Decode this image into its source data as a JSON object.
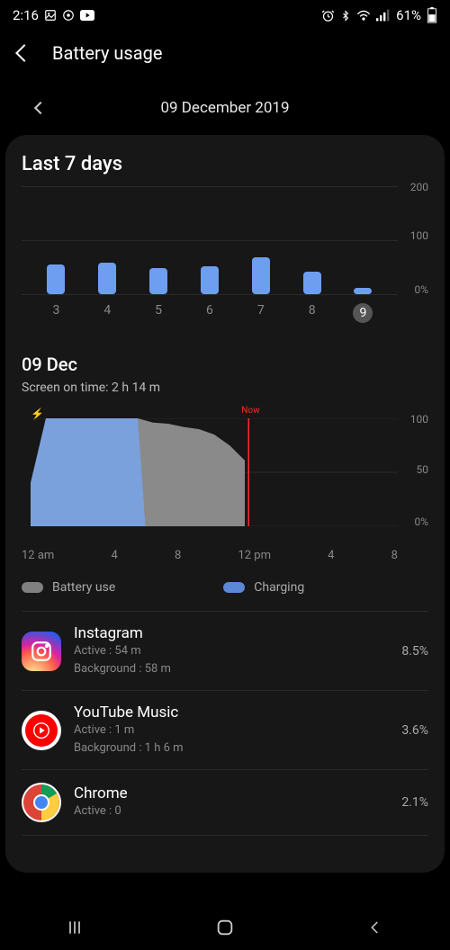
{
  "status": {
    "time": "2:16",
    "battery_pct": "61%"
  },
  "header": {
    "title": "Battery usage"
  },
  "date_nav": {
    "date": "09 December 2019"
  },
  "section_last7": {
    "title": "Last 7 days"
  },
  "chart_data": [
    {
      "type": "bar",
      "title": "Last 7 days",
      "xlabel": "",
      "ylabel": "",
      "ylim": [
        0,
        200
      ],
      "yticks": [
        "200",
        "100",
        "0%"
      ],
      "categories": [
        "3",
        "4",
        "5",
        "6",
        "7",
        "8",
        "9"
      ],
      "values": [
        55,
        58,
        48,
        52,
        68,
        42,
        12
      ],
      "selected_index": 6
    },
    {
      "type": "area",
      "title": "09 Dec battery level",
      "xlabel": "",
      "ylabel": "",
      "ylim": [
        0,
        100
      ],
      "yticks": [
        "100",
        "50",
        "0%"
      ],
      "xticks": [
        "12 am",
        "4",
        "8",
        "12 pm",
        "4",
        "8"
      ],
      "x_hours": [
        0,
        1,
        2,
        3,
        4,
        5,
        6,
        7,
        8,
        9,
        10,
        11,
        12,
        13,
        14
      ],
      "battery_pct": [
        40,
        100,
        100,
        100,
        100,
        100,
        100,
        100,
        96,
        95,
        92,
        90,
        85,
        75,
        61
      ],
      "charging_until_hour": 7.5,
      "now_hour": 14.25,
      "now_label": "Now"
    }
  ],
  "day_section": {
    "title": "09 Dec",
    "screen_on_label": "Screen on time: 2 h 14 m"
  },
  "legend": {
    "battery_use": "Battery use",
    "charging": "Charging",
    "color_use": "#808080",
    "color_charging": "#5a87d6"
  },
  "apps": [
    {
      "name": "Instagram",
      "active": "Active : 54 m",
      "background": "Background : 58 m",
      "pct": "8.5%",
      "icon": "instagram"
    },
    {
      "name": "YouTube Music",
      "active": "Active : 1 m",
      "background": "Background : 1 h 6 m",
      "pct": "3.6%",
      "icon": "ytmusic"
    },
    {
      "name": "Chrome",
      "active": "Active : 0",
      "background": "",
      "pct": "2.1%",
      "icon": "chrome"
    }
  ]
}
